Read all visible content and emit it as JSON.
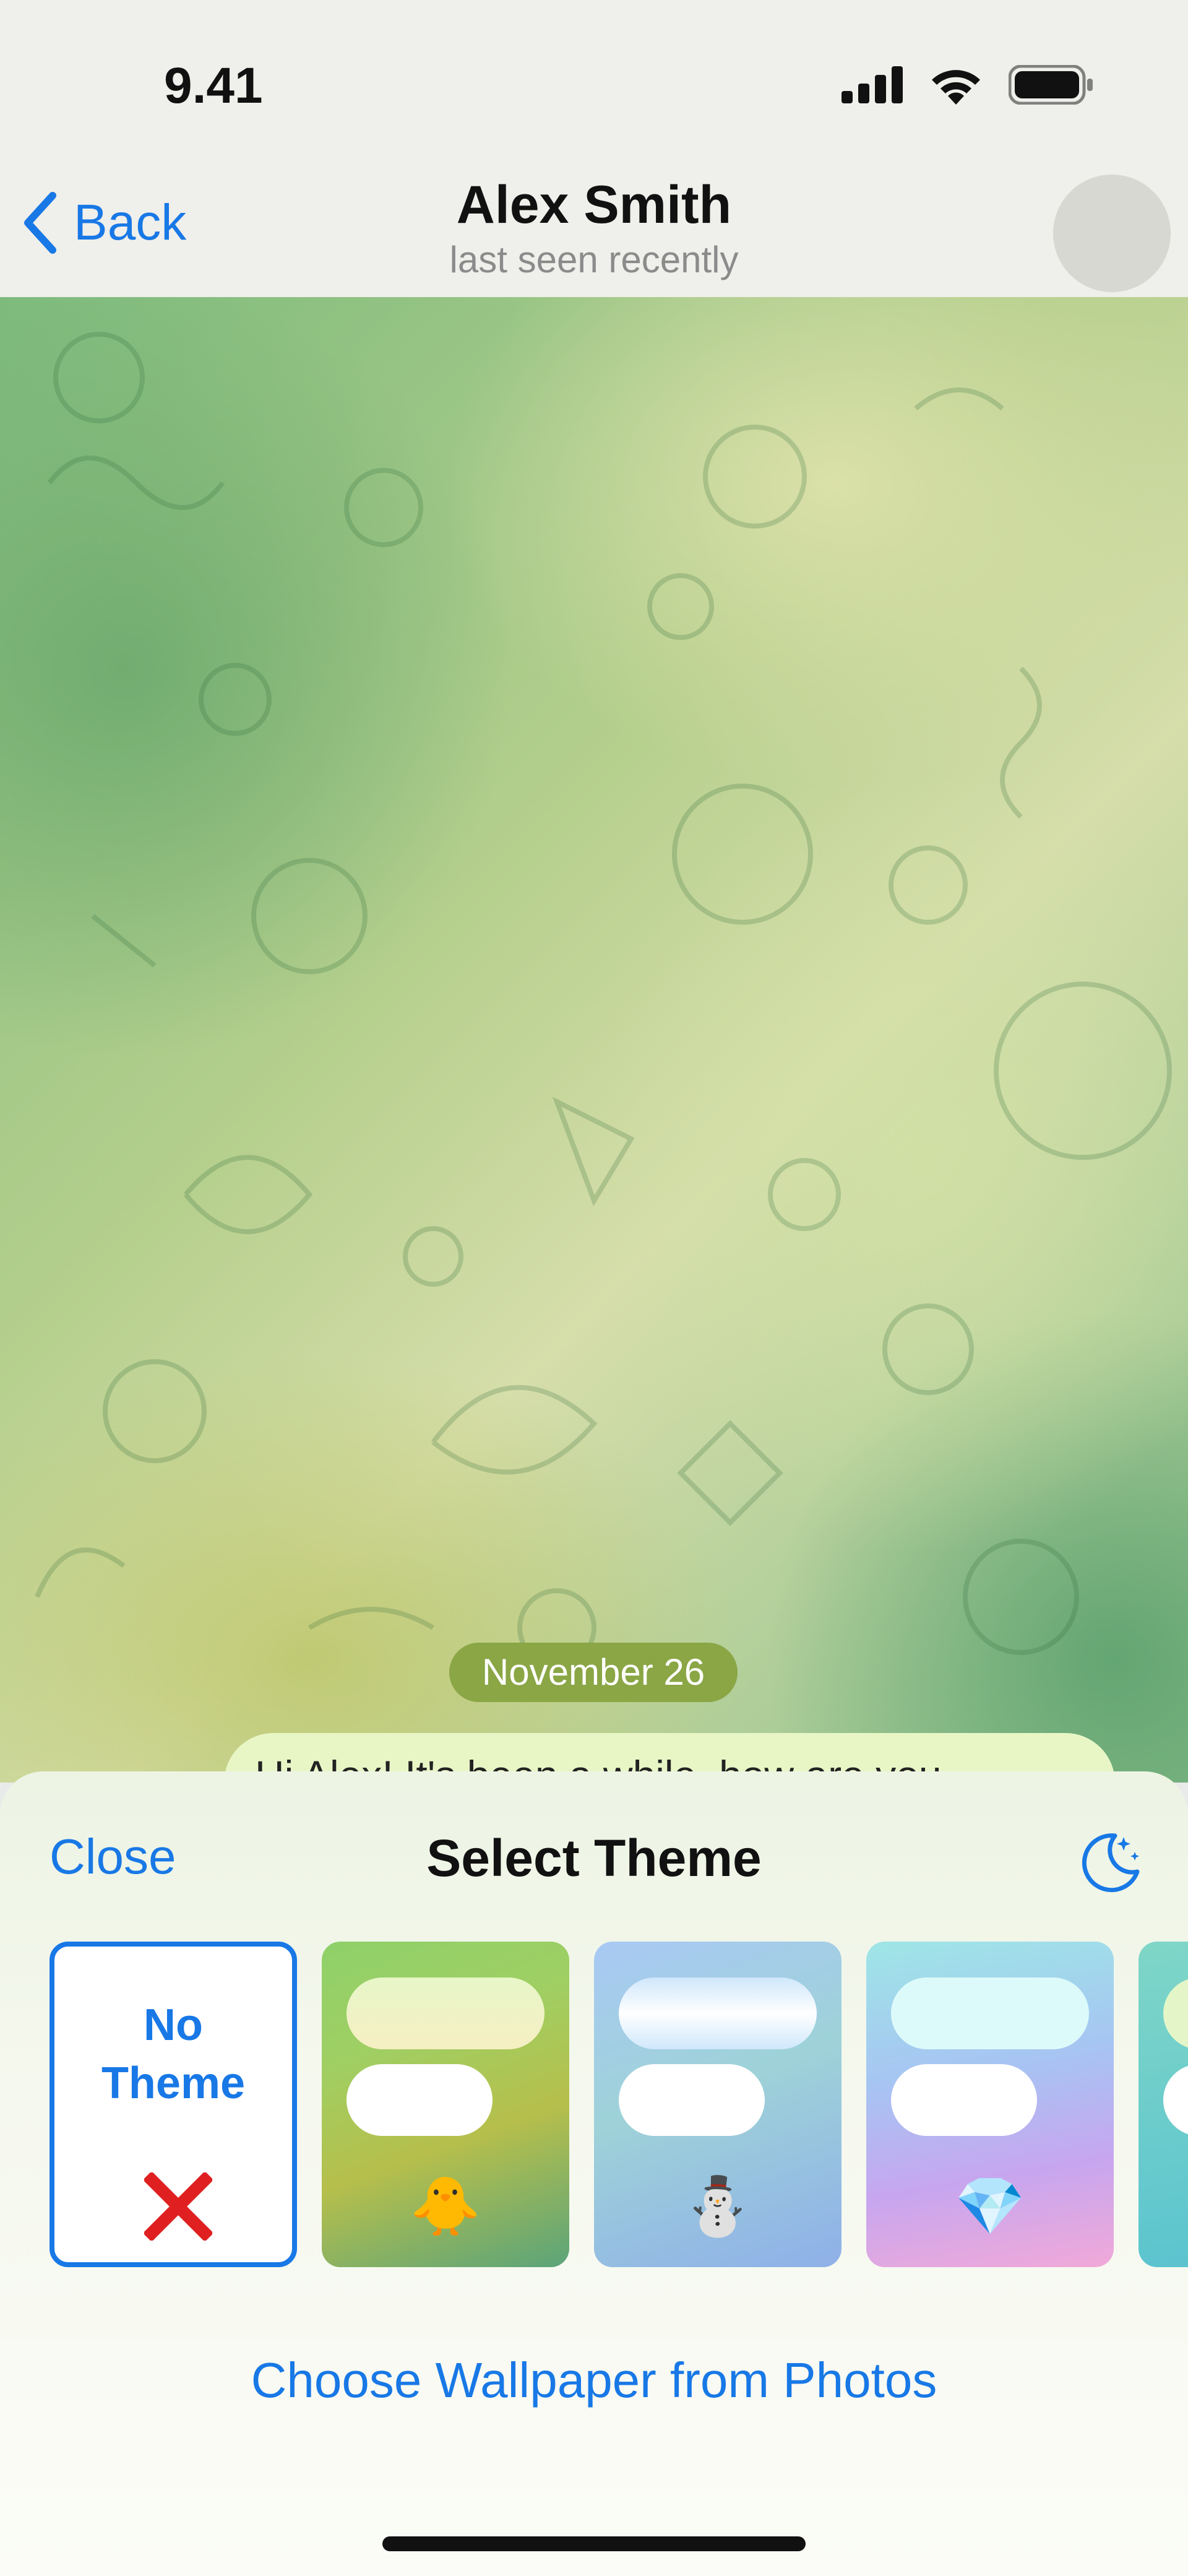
{
  "status_bar": {
    "time": "9.41"
  },
  "nav": {
    "back_label": "Back",
    "title": "Alex Smith",
    "subtitle": "last seen recently"
  },
  "chat": {
    "date": "November 26",
    "message": "Hi Alex! It's been a while, how are you"
  },
  "sheet": {
    "close_label": "Close",
    "title": "Select Theme",
    "moon_icon": "moon-stars-icon",
    "themes": [
      {
        "label": "No Theme",
        "selected": true,
        "icon": "red-x-icon",
        "accent": "#1878e6"
      },
      {
        "emoji": "🐥",
        "colors": [
          "#8fd06a",
          "#5ba47a",
          "#b6bf4b"
        ]
      },
      {
        "emoji": "⛄",
        "colors": [
          "#a9c9f4",
          "#9ed2d8",
          "#8fb0e8"
        ]
      },
      {
        "emoji": "💎",
        "colors": [
          "#9ee6e6",
          "#c7a6ef",
          "#f1a9d8"
        ]
      },
      {
        "emoji": "",
        "colors": [
          "#58c2d0",
          "#7fd6c7"
        ]
      }
    ],
    "choose_wallpaper_label": "Choose Wallpaper from Photos"
  },
  "colors": {
    "accent": "#1878e6",
    "date_pill": "#8aa645",
    "message_bubble": "#e8f6c6"
  }
}
